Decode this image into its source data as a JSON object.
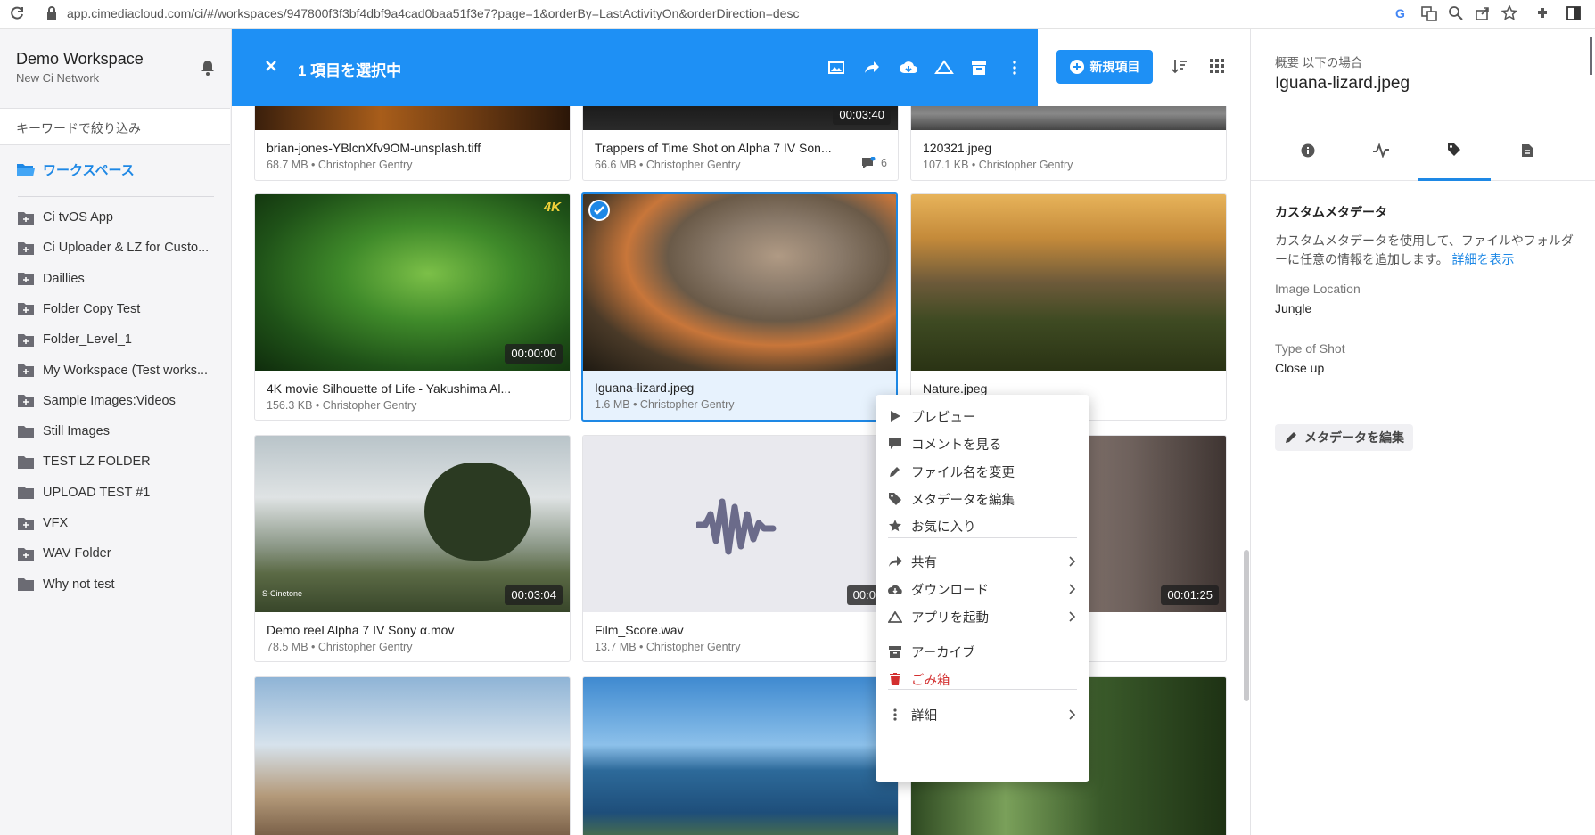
{
  "browser": {
    "url": "app.cimediacloud.com/ci/#/workspaces/947800f3f3bf4dbf9a4cad0baa51f3e7?page=1&orderBy=LastActivityOn&orderDirection=desc"
  },
  "sidebar": {
    "workspace_title": "Demo Workspace",
    "network": "New Ci Network",
    "filter_placeholder": "キーワードで絞り込み",
    "workspaces_label": "ワークスペース",
    "folders": [
      {
        "label": "Ci tvOS App",
        "icon": "folder-plus-icon"
      },
      {
        "label": "Ci Uploader & LZ for Custo...",
        "icon": "folder-plus-icon"
      },
      {
        "label": "Daillies",
        "icon": "folder-plus-icon"
      },
      {
        "label": "Folder Copy Test",
        "icon": "folder-plus-icon"
      },
      {
        "label": "Folder_Level_1",
        "icon": "folder-plus-icon"
      },
      {
        "label": "My Workspace (Test works...",
        "icon": "folder-plus-icon"
      },
      {
        "label": "Sample Images:Videos",
        "icon": "folder-plus-icon"
      },
      {
        "label": "Still Images",
        "icon": "folder-icon"
      },
      {
        "label": "TEST LZ FOLDER",
        "icon": "folder-icon"
      },
      {
        "label": "UPLOAD TEST #1",
        "icon": "folder-icon"
      },
      {
        "label": "VFX",
        "icon": "folder-plus-icon"
      },
      {
        "label": "WAV Folder",
        "icon": "folder-plus-icon"
      },
      {
        "label": "Why not test",
        "icon": "folder-icon"
      }
    ]
  },
  "topbar": {
    "selected_text": "1 項目を選択中",
    "new_item_label": "新規項目"
  },
  "grid": {
    "row0": [
      {
        "name": "brian-jones-YBlcnXfv9OM-unsplash.tiff",
        "meta": "68.7 MB • Christopher Gentry"
      },
      {
        "name": "Trappers of Time Shot on Alpha 7 IV Son...",
        "meta": "66.6 MB • Christopher Gentry",
        "duration": "00:03:40",
        "comments": "6"
      },
      {
        "name": "120321.jpeg",
        "meta": "107.1 KB • Christopher Gentry"
      }
    ],
    "row1": [
      {
        "name": "4K movie Silhouette of Life - Yakushima Al...",
        "meta": "156.3 KB • Christopher Gentry",
        "duration": "00:00:00",
        "badge": "4K"
      },
      {
        "name": "Iguana-lizard.jpeg",
        "meta": "1.6 MB • Christopher Gentry"
      },
      {
        "name": "Nature.jpeg",
        "meta": ""
      }
    ],
    "row2": [
      {
        "name": "Demo reel Alpha 7 IV Sony α.mov",
        "meta": "78.5 MB • Christopher Gentry",
        "duration": "00:03:04",
        "overlay": "S-Cinetone"
      },
      {
        "name": "Film_Score.wav",
        "meta": "13.7 MB • Christopher Gentry",
        "duration": "00:01:2"
      },
      {
        "name": "",
        "meta": "",
        "duration": "00:01:25"
      }
    ]
  },
  "context_menu": {
    "items": [
      {
        "label": "プレビュー",
        "icon": "play-icon"
      },
      {
        "label": "コメントを見る",
        "icon": "comment-icon"
      },
      {
        "label": "ファイル名を変更",
        "icon": "pencil-icon"
      },
      {
        "label": "メタデータを編集",
        "icon": "tag-icon"
      },
      {
        "label": "お気に入り",
        "icon": "star-icon"
      },
      {
        "label": "共有",
        "icon": "share-icon"
      },
      {
        "label": "ダウンロード",
        "icon": "download-icon"
      },
      {
        "label": "アプリを起動",
        "icon": "cloud-app-icon"
      },
      {
        "label": "アーカイブ",
        "icon": "archive-icon"
      },
      {
        "label": "ごみ箱",
        "icon": "trash-icon"
      },
      {
        "label": "詳細",
        "icon": "more-vertical-icon"
      }
    ]
  },
  "panel": {
    "overview_label": "概要 以下の場合",
    "file_name": "Iguana-lizard.jpeg",
    "section_title": "カスタムメタデータ",
    "description": "カスタムメタデータを使用して、ファイルやフォルダーに任意の情報を追加します。",
    "details_link": "詳細を表示",
    "fields": [
      {
        "label": "Image Location",
        "value": "Jungle"
      },
      {
        "label": "Type of Shot",
        "value": "Close up"
      }
    ],
    "edit_button": "メタデータを編集"
  },
  "colors": {
    "accent": "#1e90f5",
    "danger": "#d32f2f"
  }
}
